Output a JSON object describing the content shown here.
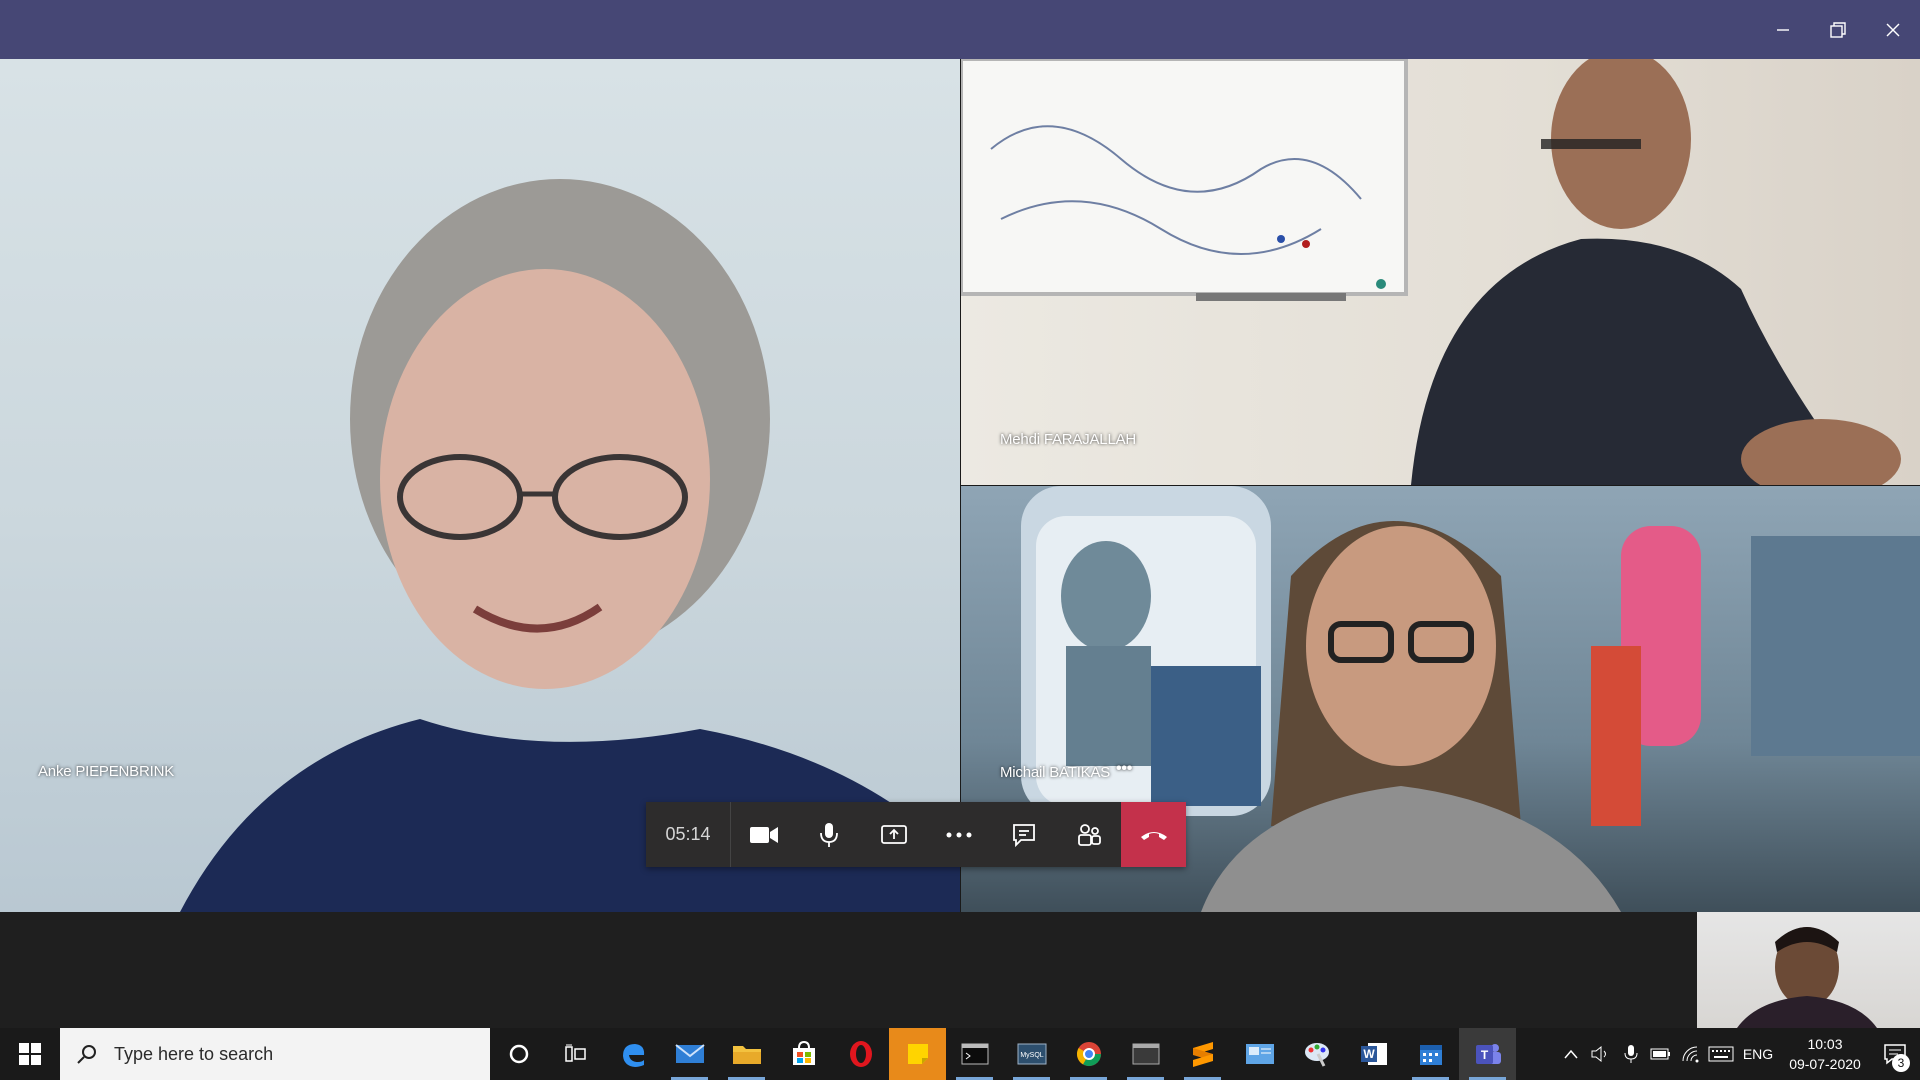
{
  "window": {
    "minimize_label": "Minimize",
    "restore_label": "Restore",
    "close_label": "Close"
  },
  "participants": [
    {
      "name": "Anke PIEPENBRINK"
    },
    {
      "name": "Mehdi FARAJALLAH"
    },
    {
      "name": "Michail BATIKAS",
      "more": "•••"
    }
  ],
  "controls": {
    "timer": "05:14",
    "icons": [
      "camera-icon",
      "microphone-icon",
      "share-screen-icon",
      "more-options-icon",
      "chat-icon",
      "participants-icon",
      "hang-up-icon"
    ]
  },
  "taskbar": {
    "search_placeholder": "Type here to search",
    "apps": [
      "cortana",
      "task-view",
      "edge",
      "mail",
      "file-explorer",
      "store",
      "opera",
      "sticky-notes",
      "terminal",
      "mysql",
      "chrome",
      "window",
      "sublime",
      "control-panel",
      "paint",
      "word",
      "calendar",
      "teams"
    ],
    "language": "ENG",
    "time": "10:03",
    "date": "09-07-2020",
    "notification_count": "3"
  },
  "colors": {
    "titlebar": "#464775",
    "hangup": "#c4314b",
    "accent_underline": "#78a6d8"
  }
}
